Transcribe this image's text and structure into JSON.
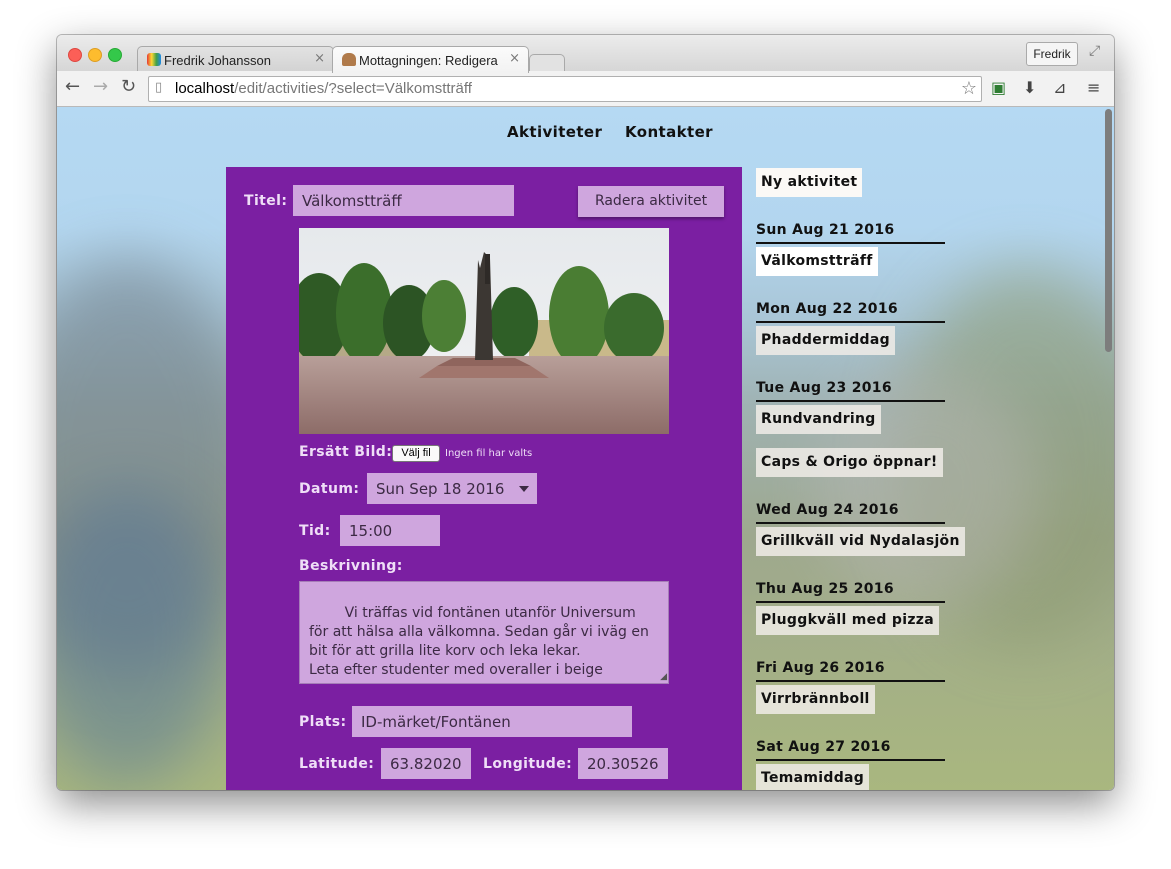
{
  "browser": {
    "tabs": [
      {
        "title": "Fredrik Johansson",
        "close": "×"
      },
      {
        "title": "Mottagningen: Redigera",
        "close": "×"
      }
    ],
    "profile": "Fredrik",
    "url_host": "localhost",
    "url_path": "/edit/activities/?select=Välkomstträff"
  },
  "nav": {
    "activities": "Aktiviteter",
    "contacts": "Kontakter"
  },
  "form": {
    "title_label": "Titel:",
    "title_value": "Välkomstträff",
    "delete_button": "Radera aktivitet",
    "replace_image_label": "Ersätt Bild:",
    "choose_file_button": "Välj fil",
    "no_file_text": "Ingen fil har valts",
    "date_label": "Datum:",
    "date_value": "Sun Sep 18 2016",
    "time_label": "Tid:",
    "time_value": "15:00",
    "description_label": "Beskrivning:",
    "description_value": "Vi träffas vid fontänen utanför Universum för att hälsa alla välkomna. Sedan går vi iväg en bit för att grilla lite korv och leka lekar.\nLeta efter studenter med overaller i beige",
    "place_label": "Plats:",
    "place_value": "ID-märket/Fontänen",
    "latitude_label": "Latitude:",
    "latitude_value": "63.82020",
    "longitude_label": "Longitude:",
    "longitude_value": "20.30526"
  },
  "sidebar": {
    "new_activity": "Ny aktivitet",
    "days": [
      {
        "date": "Sun Aug 21 2016",
        "activities": [
          "Välkomstträff"
        ]
      },
      {
        "date": "Mon Aug 22 2016",
        "activities": [
          "Phaddermiddag"
        ]
      },
      {
        "date": "Tue Aug 23 2016",
        "activities": [
          "Rundvandring",
          "Caps & Origo öppnar!"
        ]
      },
      {
        "date": "Wed Aug 24 2016",
        "activities": [
          "Grillkväll vid Nydalasjön"
        ]
      },
      {
        "date": "Thu Aug 25 2016",
        "activities": [
          "Pluggkväll med pizza"
        ]
      },
      {
        "date": "Fri Aug 26 2016",
        "activities": [
          "Virrbrännboll"
        ]
      },
      {
        "date": "Sat Aug 27 2016",
        "activities": [
          "Temamiddag"
        ]
      }
    ],
    "selected_activity": "Välkomstträff"
  },
  "colors": {
    "panel": "#7b1fa2",
    "field": "#cfa6de",
    "label_text": "#efdef7"
  }
}
